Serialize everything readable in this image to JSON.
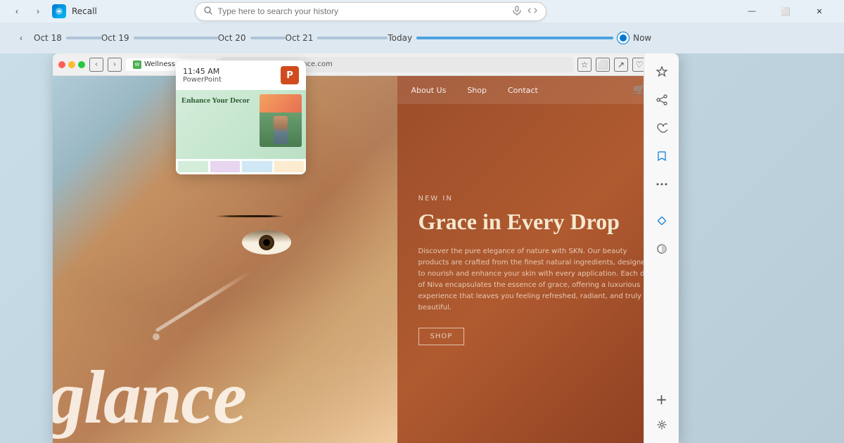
{
  "app": {
    "title": "Recall",
    "back_label": "‹",
    "forward_label": "›"
  },
  "titlebar": {
    "search_placeholder": "Type here to search your history",
    "window_controls": {
      "minimize": "—",
      "maximize": "⬜",
      "close": "✕"
    }
  },
  "timeline": {
    "nav_back": "‹",
    "dates": [
      "Oct 18",
      "Oct 19",
      "Oct 20",
      "Oct 21",
      "Today",
      "Now"
    ],
    "now_label": "Now"
  },
  "browser": {
    "url": "https://wellnessglance.com",
    "tab_title": "Wellness Glance",
    "nav": {
      "about": "About Us",
      "shop": "Shop",
      "contact": "Contact"
    }
  },
  "site": {
    "new_in_label": "NEW IN",
    "title_line1": "Grace in Every Drop",
    "description": "Discover the pure elegance of nature with SKN. Our beauty products are crafted from the finest natural ingredients, designed to nourish and enhance your skin with every application. Each drop of Niva encapsulates the essence of grace, offering a luxurious experience that leaves you feeling refreshed, radiant, and truly beautiful.",
    "shop_btn": "SHOP",
    "big_text": "glance"
  },
  "popup": {
    "time": "11:45 AM",
    "app_name": "PowerPoint",
    "icon_label": "P",
    "slide_title": "Enhance Your Decor",
    "slide_subtitle": ""
  },
  "sidebar": {
    "buttons": [
      "☆",
      "↗",
      "♡",
      "🔖",
      "⋯",
      "🔷",
      "◑"
    ],
    "add": "+",
    "settings": "⚙"
  },
  "colors": {
    "accent": "#0078d4",
    "timeline_active": "#4da3e0",
    "site_bg": "#a0522d",
    "popup_ppt": "#d04c1e"
  }
}
